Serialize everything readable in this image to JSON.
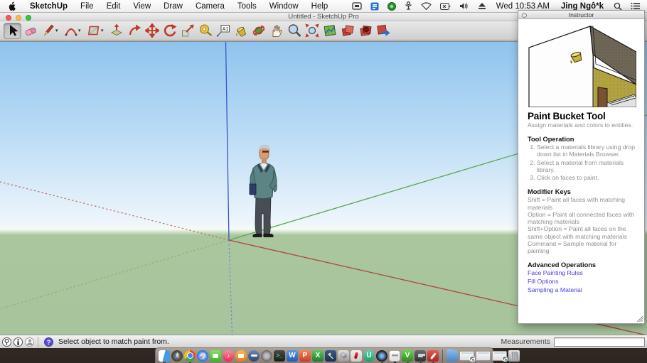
{
  "menubar": {
    "items": [
      "SketchUp",
      "File",
      "Edit",
      "View",
      "Draw",
      "Camera",
      "Tools",
      "Window",
      "Help"
    ],
    "clock": "Wed 10:53 AM",
    "user": "Jing Ngô*k"
  },
  "window": {
    "title": "Untitled - SketchUp Pro"
  },
  "toolbar": {
    "a1_label": "A1",
    "active_tool": "paint-bucket",
    "tools": [
      "select",
      "eraser",
      "line",
      "arc",
      "rectangle",
      "push-pull",
      "follow-me",
      "move",
      "rotate",
      "scale",
      "tape-measure",
      "dimension-text",
      "paint-bucket",
      "orbit",
      "pan",
      "zoom",
      "zoom-extents",
      "add-location",
      "get-models",
      "extension-warehouse",
      "share-model"
    ]
  },
  "viewport": {
    "axis_colors": {
      "red": "#b0443a",
      "green": "#58a84b",
      "blue": "#3c55c8"
    },
    "figure": "man-standing"
  },
  "instructor": {
    "title": "Instructor",
    "heading": "Paint Bucket Tool",
    "subtitle": "Assign materials and colors to entities.",
    "tool_operation": {
      "heading": "Tool Operation",
      "steps": [
        "Select a materials library using drop down list in Materials Browser.",
        "Select a material from materials library.",
        "Click on faces to paint."
      ]
    },
    "modifier_keys": {
      "heading": "Modifier Keys",
      "lines": [
        "Shift = Paint all faces with matching materials",
        "Option = Paint all connected faces with matching materials",
        "Shift+Option = Paint all faces on the same object with matching materials",
        "Command = Sample material for painting"
      ]
    },
    "advanced_operations": {
      "heading": "Advanced Operations",
      "links": [
        "Face Painting Rules",
        "Fill Options",
        "Sampling a Material"
      ]
    },
    "link_color": "#4a3ee8"
  },
  "statusbar": {
    "hint": "Select object to match paint from.",
    "help_glyph": "?",
    "measurements_label": "Measurements",
    "measurements_value": ""
  },
  "dock": {
    "glyphs": {
      "itunes": "♪",
      "word": "W",
      "powerpoint": "P",
      "excel": "X",
      "utorrent": "U",
      "vapp": "V",
      "terminal": ">_"
    },
    "apps": [
      "finder",
      "launchpad",
      "chrome",
      "safari",
      "facetime",
      "itunes",
      "ibooks",
      "blue-app",
      "gray-app",
      "terminal",
      "word",
      "powerpoint",
      "excel",
      "xcode",
      "style-builder",
      "torch",
      "utorrent",
      "camera-lens",
      "textedit",
      "v-app",
      "movie-capture",
      "sketchup",
      "downloads-folder",
      "window-1",
      "window-2",
      "window-3",
      "trash"
    ]
  }
}
